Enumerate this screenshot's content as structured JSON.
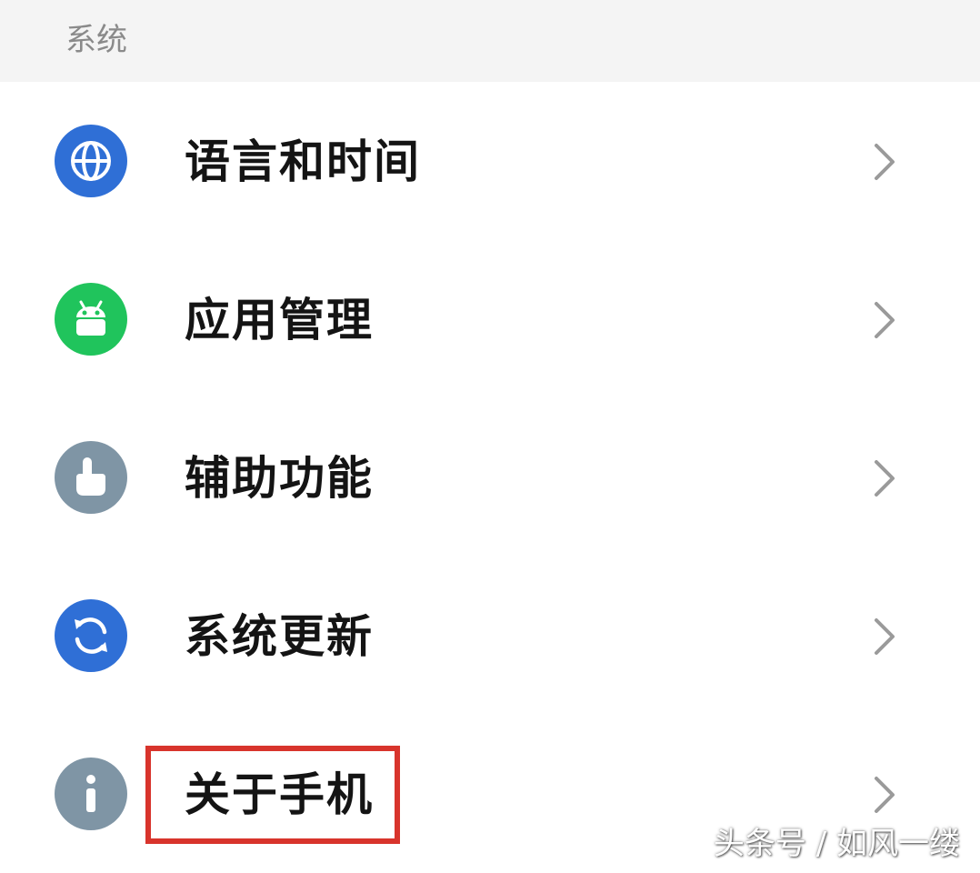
{
  "section": {
    "title": "系统"
  },
  "items": [
    {
      "label": "语言和时间",
      "icon": "globe-icon",
      "icon_color": "#2f6fd6"
    },
    {
      "label": "应用管理",
      "icon": "android-icon",
      "icon_color": "#20c45c"
    },
    {
      "label": "辅助功能",
      "icon": "hand-pointer-icon",
      "icon_color": "#7f95a5"
    },
    {
      "label": "系统更新",
      "icon": "sync-icon",
      "icon_color": "#2f6fd6"
    },
    {
      "label": "关于手机",
      "icon": "info-icon",
      "icon_color": "#7f95a5"
    }
  ],
  "highlight": {
    "target": "关于手机",
    "color": "#d8342c"
  },
  "watermark": "头条号 / 如风一缕"
}
